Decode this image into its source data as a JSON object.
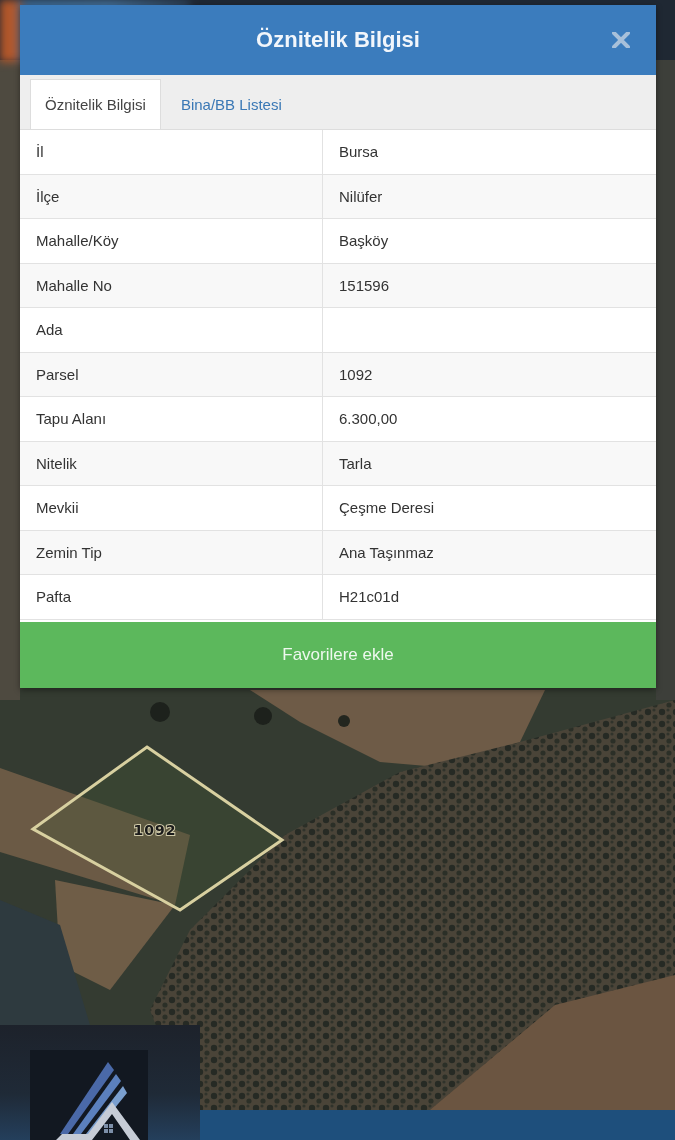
{
  "dialog": {
    "title": "Öznitelik Bilgisi",
    "tabs": [
      {
        "label": "Öznitelik Bilgisi",
        "selected": true
      },
      {
        "label": "Bina/BB Listesi",
        "selected": false
      }
    ],
    "rows": [
      {
        "label": "İl",
        "value": "Bursa"
      },
      {
        "label": "İlçe",
        "value": "Nilüfer"
      },
      {
        "label": "Mahalle/Köy",
        "value": "Başköy"
      },
      {
        "label": "Mahalle No",
        "value": "151596"
      },
      {
        "label": "Ada"
      },
      {
        "label": "Parsel",
        "value": "1092"
      },
      {
        "label": "Tapu Alanı",
        "value": "6.300,00"
      },
      {
        "label": "Nitelik",
        "value": "Tarla"
      },
      {
        "label": "Mevkii",
        "value": "Çeşme Deresi"
      },
      {
        "label": "Zemin Tip",
        "value": "Ana Taşınmaz"
      },
      {
        "label": "Pafta",
        "value": "H21c01d"
      }
    ],
    "button": "Favorilere ekle"
  },
  "map": {
    "parcel_label": "1092"
  }
}
